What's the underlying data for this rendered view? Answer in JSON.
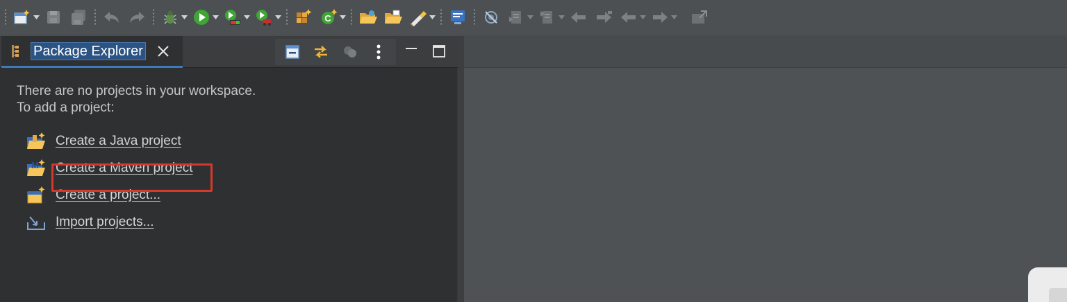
{
  "panel": {
    "tab_title": "Package Explorer",
    "message_line1": "There are no projects in your workspace.",
    "message_line2": "To add a project:"
  },
  "links": [
    {
      "label": "Create a Java project",
      "icon": "new-java-project-icon"
    },
    {
      "label": "Create a Maven project",
      "icon": "new-maven-project-icon"
    },
    {
      "label": "Create a project...",
      "icon": "new-project-icon"
    },
    {
      "label": "Import projects...",
      "icon": "import-icon"
    }
  ],
  "colors": {
    "highlight": "#d6392b",
    "tab_selection": "#2b5484",
    "active_tab_underline": "#3d7ab8"
  }
}
